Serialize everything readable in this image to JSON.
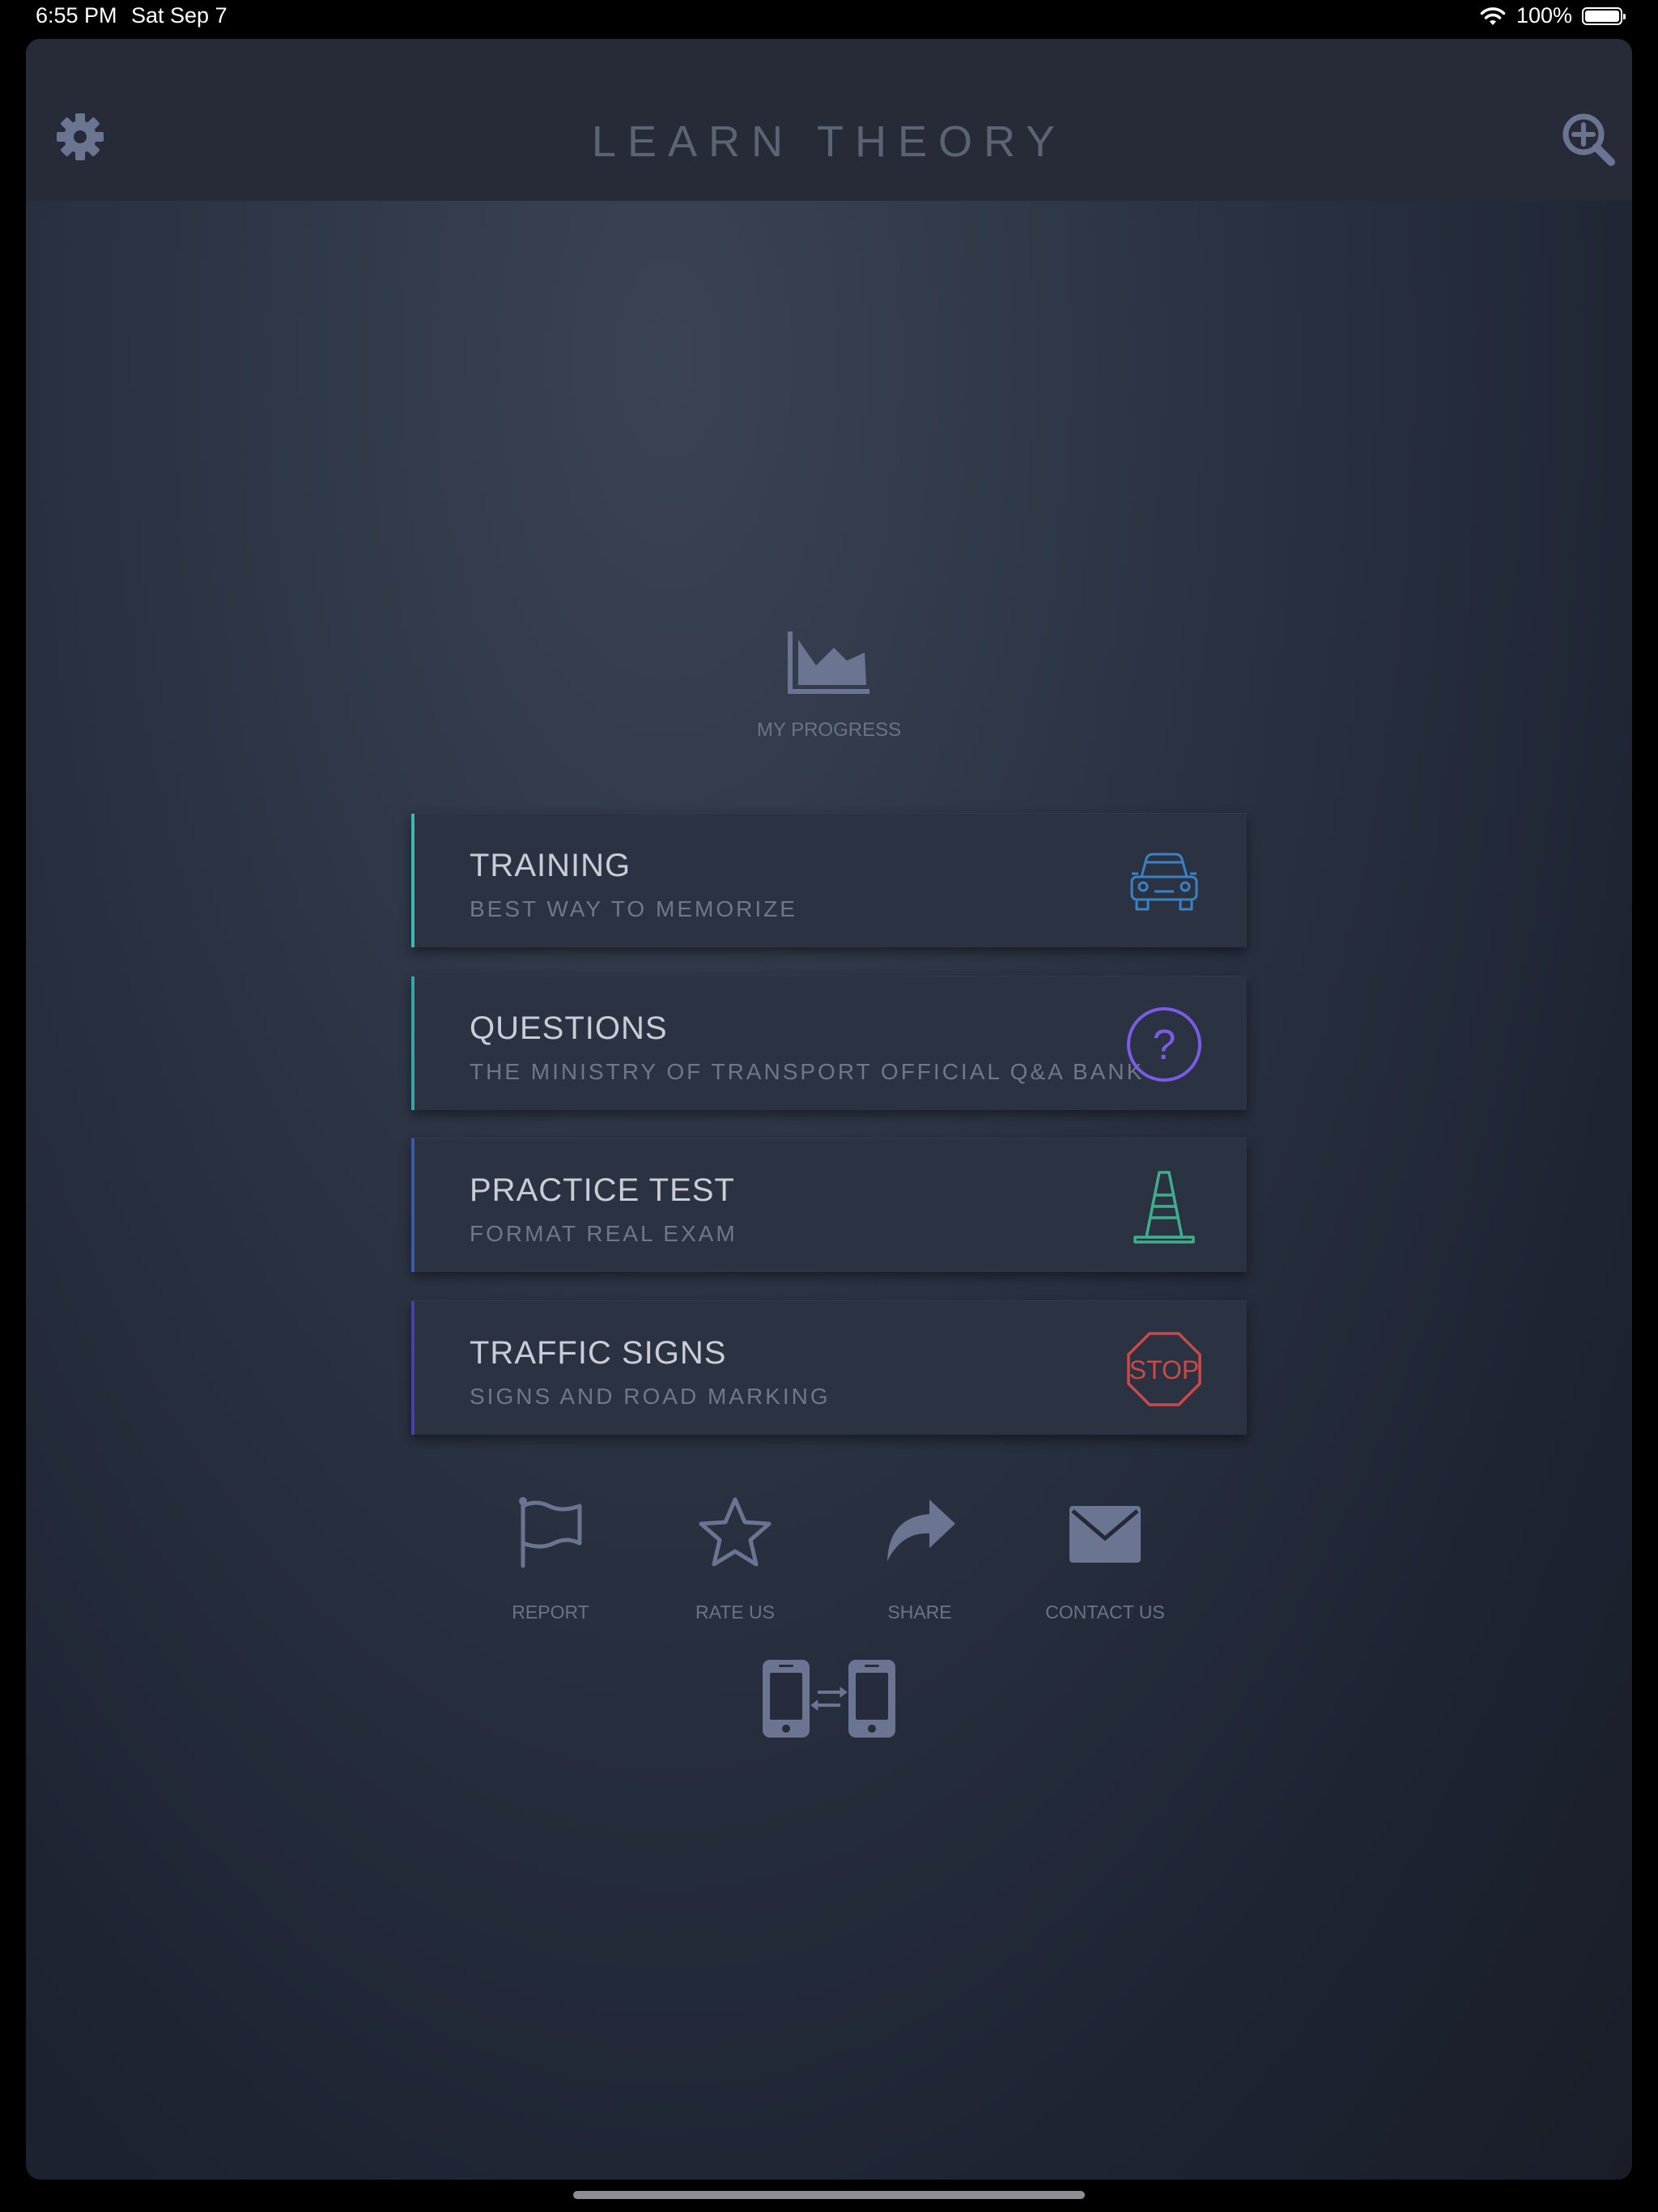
{
  "status_bar": {
    "time": "6:55 PM",
    "date": "Sat Sep 7",
    "battery": "100%"
  },
  "header": {
    "title": "LEARN THEORY",
    "left_icon": "gear-icon",
    "right_icon": "zoom-in-icon"
  },
  "progress": {
    "label": "MY PROGRESS",
    "icon": "area-chart-icon"
  },
  "menu": [
    {
      "title": "TRAINING",
      "subtitle": "BEST WAY TO MEMORIZE",
      "icon": "car-icon",
      "accent": "#3fb6b0",
      "icon_color": "#3b82c4"
    },
    {
      "title": "QUESTIONS",
      "subtitle": "THE MINISTRY OF TRANSPORT OFFICIAL Q&A BANK",
      "icon": "question-circle-icon",
      "accent": "#3aa3a8",
      "icon_color": "#7b5ce6"
    },
    {
      "title": "PRACTICE TEST",
      "subtitle": "FORMAT REAL EXAM",
      "icon": "traffic-cone-icon",
      "accent": "#3d5aa8",
      "icon_color": "#3fae8c"
    },
    {
      "title": "TRAFFIC SIGNS",
      "subtitle": "SIGNS AND ROAD MARKING",
      "icon": "stop-sign-icon",
      "accent": "#4a3ea8",
      "icon_color": "#c94a4a",
      "icon_text": "STOP"
    }
  ],
  "actions": [
    {
      "label": "REPORT",
      "icon": "flag-icon"
    },
    {
      "label": "RATE US",
      "icon": "star-icon"
    },
    {
      "label": "SHARE",
      "icon": "share-arrow-icon"
    },
    {
      "label": "CONTACT US",
      "icon": "envelope-icon"
    }
  ],
  "sync": {
    "icon": "device-sync-icon"
  },
  "colors": {
    "header_bg": "#262b37",
    "card_bg": "#2b3241",
    "icon_muted": "#6b7592"
  }
}
